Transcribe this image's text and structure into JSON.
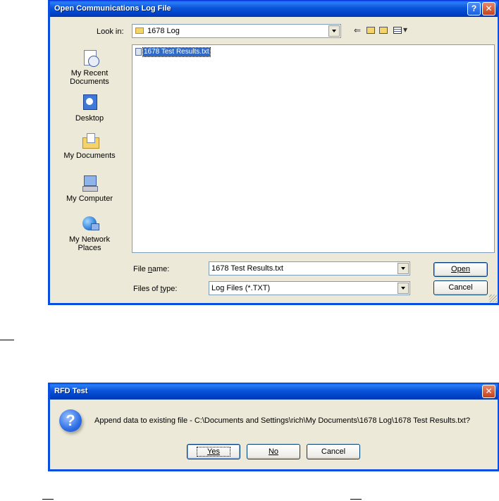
{
  "open_dialog": {
    "title": "Open Communications Log File",
    "look_in_label": "Look in:",
    "look_in_value": "1678 Log",
    "places": [
      {
        "label": "My Recent Documents"
      },
      {
        "label": "Desktop"
      },
      {
        "label": "My Documents"
      },
      {
        "label": "My Computer"
      },
      {
        "label": "My Network Places"
      }
    ],
    "files": [
      "1678 Test Results.txt"
    ],
    "file_name_label": "File name:",
    "file_name_value": "1678 Test Results.txt",
    "file_type_label": "Files of type:",
    "file_type_value": "Log Files (*.TXT)",
    "open_label": "Open",
    "cancel_label": "Cancel"
  },
  "rfd_dialog": {
    "title": "RFD Test",
    "message": "Append data to existing file - C:\\Documents and Settings\\rich\\My Documents\\1678 Log\\1678 Test Results.txt?",
    "yes_label": "Yes",
    "no_label": "No",
    "cancel_label": "Cancel"
  },
  "colors": {
    "title_bar": "#0a54d9",
    "window_bg": "#ece9d8",
    "selection": "#316ac5"
  }
}
